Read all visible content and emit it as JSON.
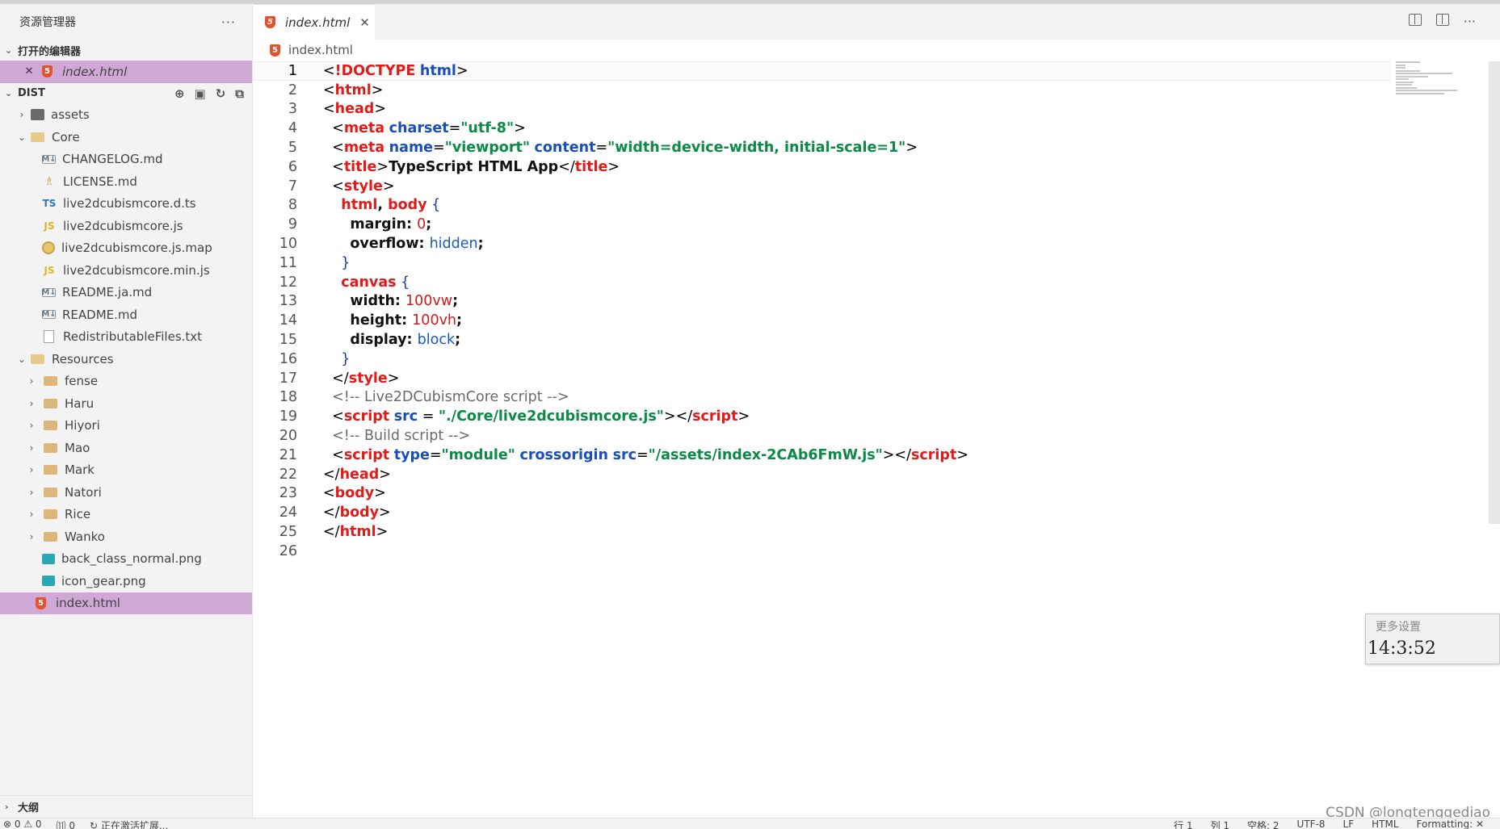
{
  "sidebar": {
    "title": "资源管理器",
    "more": "···",
    "open_editors_title": "打开的编辑器",
    "open_editors": [
      {
        "label": "index.html"
      }
    ],
    "dist_title": "DIST",
    "tree": [
      {
        "label": "assets"
      },
      {
        "label": "Core"
      },
      {
        "label": "CHANGELOG.md"
      },
      {
        "label": "LICENSE.md"
      },
      {
        "label": "live2dcubismcore.d.ts"
      },
      {
        "label": "live2dcubismcore.js"
      },
      {
        "label": "live2dcubismcore.js.map"
      },
      {
        "label": "live2dcubismcore.min.js"
      },
      {
        "label": "README.ja.md"
      },
      {
        "label": "README.md"
      },
      {
        "label": "RedistributableFiles.txt"
      },
      {
        "label": "Resources"
      },
      {
        "label": "fense"
      },
      {
        "label": "Haru"
      },
      {
        "label": "Hiyori"
      },
      {
        "label": "Mao"
      },
      {
        "label": "Mark"
      },
      {
        "label": "Natori"
      },
      {
        "label": "Rice"
      },
      {
        "label": "Wanko"
      },
      {
        "label": "back_class_normal.png"
      },
      {
        "label": "icon_gear.png"
      },
      {
        "label": "index.html"
      }
    ],
    "outline_title": "大纲"
  },
  "editor": {
    "tab_label": "index.html",
    "breadcrumb": "index.html",
    "line_numbers": [
      "1",
      "2",
      "3",
      "4",
      "5",
      "6",
      "7",
      "8",
      "9",
      "10",
      "11",
      "12",
      "13",
      "14",
      "15",
      "16",
      "17",
      "18",
      "19",
      "20",
      "21",
      "22",
      "23",
      "24",
      "25",
      "26"
    ],
    "code": {
      "l1_doctype": "!DOCTYPE",
      "l1_html": "html",
      "html": "html",
      "head": "head",
      "meta": "meta",
      "charset": "charset",
      "utf8": "\"utf-8\"",
      "name": "name",
      "viewport": "\"viewport\"",
      "content": "content",
      "content_val": "\"width=device-width, initial-scale=1\"",
      "title": "title",
      "title_text": "TypeScript HTML App",
      "style": "style",
      "sel_html": "html",
      "sel_body": "body",
      "margin": "margin",
      "zero": "0",
      "overflow": "overflow",
      "hidden": "hidden",
      "canvas": "canvas",
      "width": "width",
      "w100": "100vw",
      "height": "height",
      "h100": "100vh",
      "display": "display",
      "block": "block",
      "comment1": "<!-- Live2DCubismCore script -->",
      "script": "script",
      "src": "src",
      "src1": "\"./Core/live2dcubismcore.js\"",
      "comment2": "<!-- Build script -->",
      "type": "type",
      "module": "\"module\"",
      "crossorigin": "crossorigin",
      "src2": "\"/assets/index-2CAb6FmW.js\"",
      "body": "body"
    }
  },
  "popup": {
    "title": "更多设置",
    "clock": "14:3:52"
  },
  "watermark": "CSDN @longtenggediao",
  "statusbar": {
    "errors": "⊗ 0 ⚠ 0",
    "ports": "⑾ 0",
    "activity": "↻ 正在激活扩展...",
    "line": "行 1",
    "col": "列 1",
    "spaces": "空格: 2",
    "encoding": "UTF-8",
    "eol": "LF",
    "lang": "HTML",
    "formatting": "Formatting: ✕"
  }
}
